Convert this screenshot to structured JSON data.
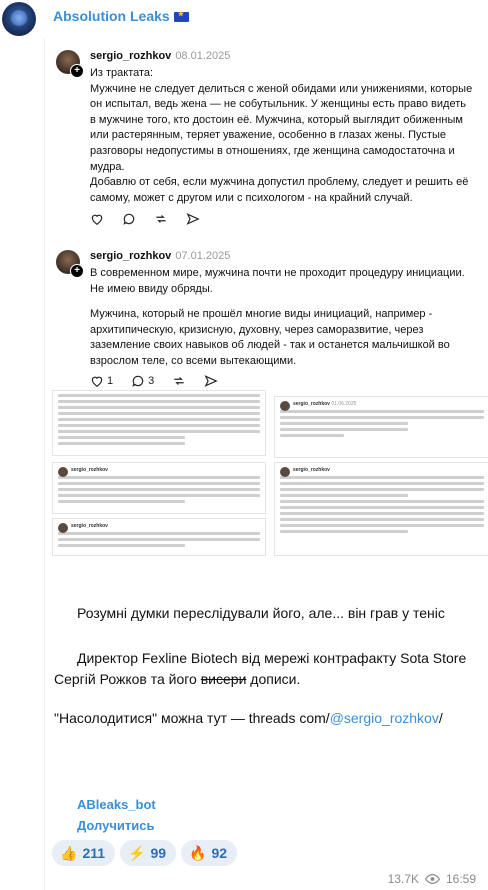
{
  "channel": {
    "title": "Absolution Leaks",
    "flag": "EU"
  },
  "post1": {
    "username": "sergio_rozhkov",
    "date": "08.01.2025",
    "paragraphs": [
      "Из трактата:",
      "Мужчине не следует делиться с женой обидами или унижениями, которые он испытал, ведь жена — не собутыльник. У женщины есть право видеть в мужчине того, кто достоин её. Мужчина, который выглядит обиженным или растерянным, теряет уважение, особенно в глазах жены. Пустые разговоры недопустимы в отношениях, где женщина самодостаточна и мудра.",
      "Добавлю от себя, если мужчина допустил проблему, следует и решить её самому, может с другом или с психологом - на крайний случай."
    ]
  },
  "post2": {
    "username": "sergio_rozhkov",
    "date": "07.01.2025",
    "paragraphs": [
      "В современном мире, мужчина почти не проходит процедуру инициации. Не имею ввиду обряды.",
      "Мужчина, который не прошёл многие виды инициаций, например - архитипическую, кризисную, духовну, через саморазвитие, через заземление своих навыков об людей - так и останется мальчишкой во взрослом теле, со всеми вытекающими."
    ],
    "likes": "1",
    "comments": "3"
  },
  "thumbs": {
    "t1_user": "sergio_rozhkov",
    "t1_date": "01.06.2025",
    "t2_user": "sergio_rozhkov",
    "t3_user": "sergio_rozhkov",
    "t4_user": "sergio_rozhkov",
    "t1_text": "Если бы у тебя была возможность осуществить свою мечту, и всё бы получилось, то ты знаешь что с тобой будет?",
    "t2_text": "Мене бы стало больше времени на себя, но эмоции остались бы прежними."
  },
  "message": {
    "line1": "Розумні думки переслідували його, але... він грав у теніс",
    "line2_a": "Директор Fexline Biotech від мережі контрафакту Sota Store Сергій Рожков та його ",
    "line2_strike": "висери",
    "line2_b": " дописи.",
    "line3_a": "\"Насолодитися\" можна тут — threads com/",
    "line3_link": "@sergio_rozhkov",
    "line3_b": "/"
  },
  "bot": {
    "name": "ABleaks_bot",
    "action": "Долучитись"
  },
  "reactions": [
    {
      "emoji": "👍",
      "count": "211"
    },
    {
      "emoji": "⚡",
      "count": "99"
    },
    {
      "emoji": "🔥",
      "count": "92"
    }
  ],
  "meta": {
    "views": "13.7K",
    "time": "16:59"
  },
  "colors": {
    "accent": "#3a8fd6",
    "reaction_bg": "#e8eef6"
  }
}
